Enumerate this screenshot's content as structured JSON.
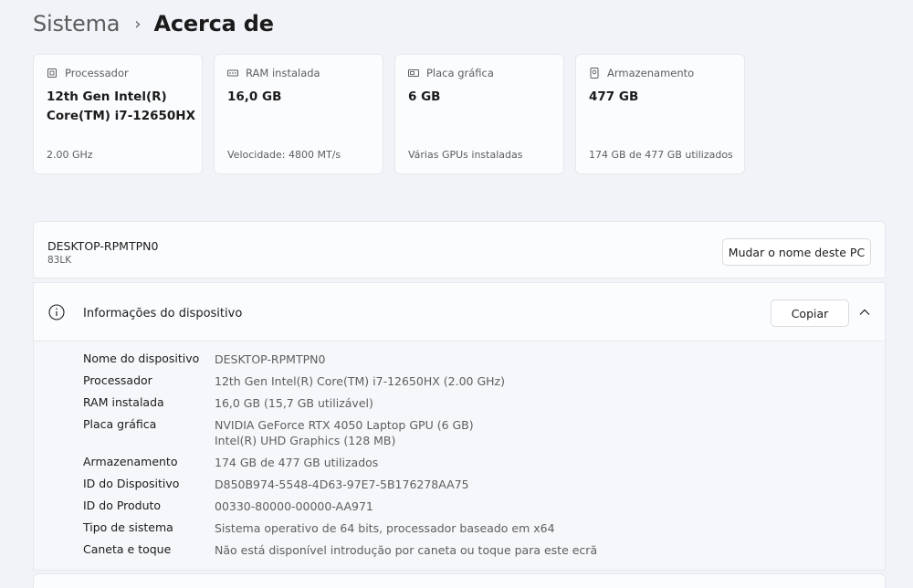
{
  "breadcrumb": {
    "parent": "Sistema",
    "separator": "›",
    "current": "Acerca de"
  },
  "spec_cards": [
    {
      "label": "Processador",
      "value": "12th Gen Intel(R) Core(TM) i7-12650HX",
      "sub": "2.00 GHz",
      "icon": "processor-icon"
    },
    {
      "label": "RAM instalada",
      "value": "16,0 GB",
      "sub": "Velocidade: 4800 MT/s",
      "icon": "ram-icon"
    },
    {
      "label": "Placa gráfica",
      "value": "6 GB",
      "sub": "Várias GPUs instaladas",
      "icon": "graphics-card-icon"
    },
    {
      "label": "Armazenamento",
      "value": "477 GB",
      "sub": "174 GB de 477 GB utilizados",
      "icon": "storage-icon"
    }
  ],
  "pc": {
    "name": "DESKTOP-RPMTPN0",
    "model": "83LK",
    "rename_label": "Mudar o nome deste PC"
  },
  "device_info": {
    "title": "Informações do dispositivo",
    "copy_label": "Copiar",
    "rows": [
      {
        "key": "Nome do dispositivo",
        "value": "DESKTOP-RPMTPN0"
      },
      {
        "key": "Processador",
        "value": "12th Gen Intel(R) Core(TM) i7-12650HX (2.00 GHz)"
      },
      {
        "key": "RAM instalada",
        "value": "16,0 GB (15,7 GB utilizável)"
      },
      {
        "key": "Placa gráfica",
        "value": "NVIDIA GeForce RTX 4050 Laptop GPU (6 GB)",
        "value2": "Intel(R) UHD Graphics (128 MB)"
      },
      {
        "key": "Armazenamento",
        "value": "174 GB de 477 GB utilizados"
      },
      {
        "key": "ID do Dispositivo",
        "value": "D850B974-5548-4D63-97E7-5B176278AA75"
      },
      {
        "key": "ID do Produto",
        "value": "00330-80000-00000-AA971"
      },
      {
        "key": "Tipo de sistema",
        "value": "Sistema operativo de 64 bits, processador baseado em x64"
      },
      {
        "key": "Caneta e toque",
        "value": "Não está disponível introdução por caneta ou toque para este ecrã"
      }
    ]
  },
  "colors": {
    "background": "#f1f3f8",
    "card": "#fbfcfe",
    "text": "#1b1b1b",
    "secondary_text": "#5e5e5e"
  }
}
